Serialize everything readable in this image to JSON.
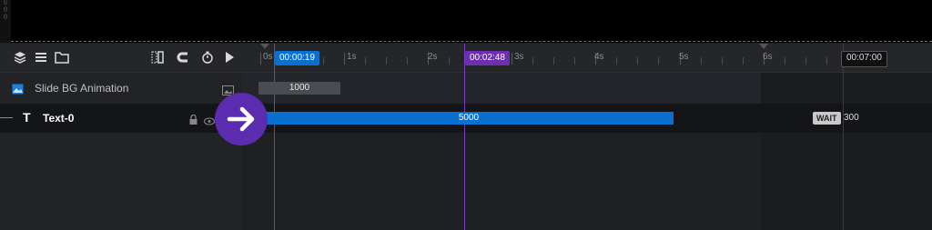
{
  "canvas_ruler": [
    "6",
    "0",
    "0"
  ],
  "toolbar": {
    "layers_icon": "layers-icon",
    "list_icon": "list-icon",
    "folder_icon": "folder-icon",
    "snap_icon": "snap-grid-icon",
    "magnet_icon": "magnet-icon",
    "timer_icon": "stopwatch-icon",
    "play_icon": "play-icon"
  },
  "timeline": {
    "current_time": "00:00:19",
    "hover_time": "00:02:48",
    "end_time": "00:07:00",
    "tick_labels": [
      "0s",
      "1s",
      "2s",
      "3s",
      "4s",
      "5s",
      "6s"
    ]
  },
  "layers": [
    {
      "name": "Slide BG Animation",
      "icon": "image-icon",
      "duration": "1000",
      "right_icon": "image-small-icon"
    },
    {
      "name": "Text-0",
      "icon": "text-icon",
      "duration": "5000",
      "wait_label": "WAIT",
      "wait_value": "300",
      "lock_icon": "lock-icon",
      "visibility_icon": "eye-icon"
    }
  ],
  "overlay": {
    "icon": "arrow-right-icon",
    "color": "#5b2bb0"
  },
  "colors": {
    "accent_blue": "#0b6fd0",
    "accent_purple": "#6d2fb0"
  }
}
